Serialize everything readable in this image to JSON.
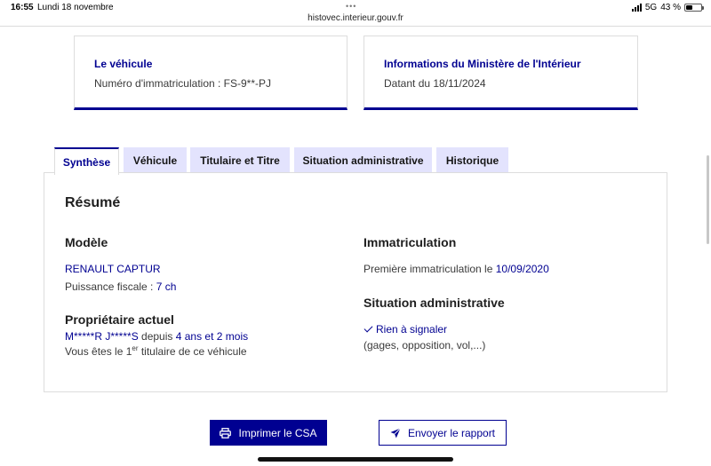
{
  "status_bar": {
    "time": "16:55",
    "date": "Lundi 18 novembre",
    "dots": "•••",
    "url": "histovec.interieur.gouv.fr",
    "network": "5G",
    "battery": "43 %"
  },
  "cards": {
    "vehicle": {
      "title": "Le véhicule",
      "text": "Numéro d'immatriculation : FS-9**-PJ"
    },
    "ministry": {
      "title": "Informations du Ministère de l'Intérieur",
      "text": "Datant du 18/11/2024"
    }
  },
  "tabs": [
    {
      "label": "Synthèse",
      "active": true
    },
    {
      "label": "Véhicule",
      "active": false
    },
    {
      "label": "Titulaire et Titre",
      "active": false
    },
    {
      "label": "Situation administrative",
      "active": false
    },
    {
      "label": "Historique",
      "active": false
    }
  ],
  "summary": {
    "title": "Résumé",
    "model": {
      "heading": "Modèle",
      "name": "RENAULT CAPTUR",
      "power_label": "Puissance fiscale : ",
      "power_value": "7 ch"
    },
    "owner": {
      "heading": "Propriétaire actuel",
      "name": "M*****R J*****S",
      "since_label": " depuis ",
      "since_value": "4 ans et 2 mois",
      "rank_prefix": "Vous êtes le 1",
      "rank_sup": "er",
      "rank_suffix": " titulaire de ce véhicule"
    },
    "registration": {
      "heading": "Immatriculation",
      "label": "Première immatriculation le ",
      "date": "10/09/2020"
    },
    "admin": {
      "heading": "Situation administrative",
      "status": "Rien à signaler",
      "note": "(gages, opposition, vol,...)"
    }
  },
  "actions": {
    "print_label": "Imprimer le CSA",
    "send_label": "Envoyer le rapport"
  },
  "colors": {
    "primary": "#000091",
    "tab_inactive": "#e3e3fd",
    "text": "#3a3a3a"
  },
  "icons": [
    "printer-icon",
    "send-icon",
    "check-icon"
  ]
}
